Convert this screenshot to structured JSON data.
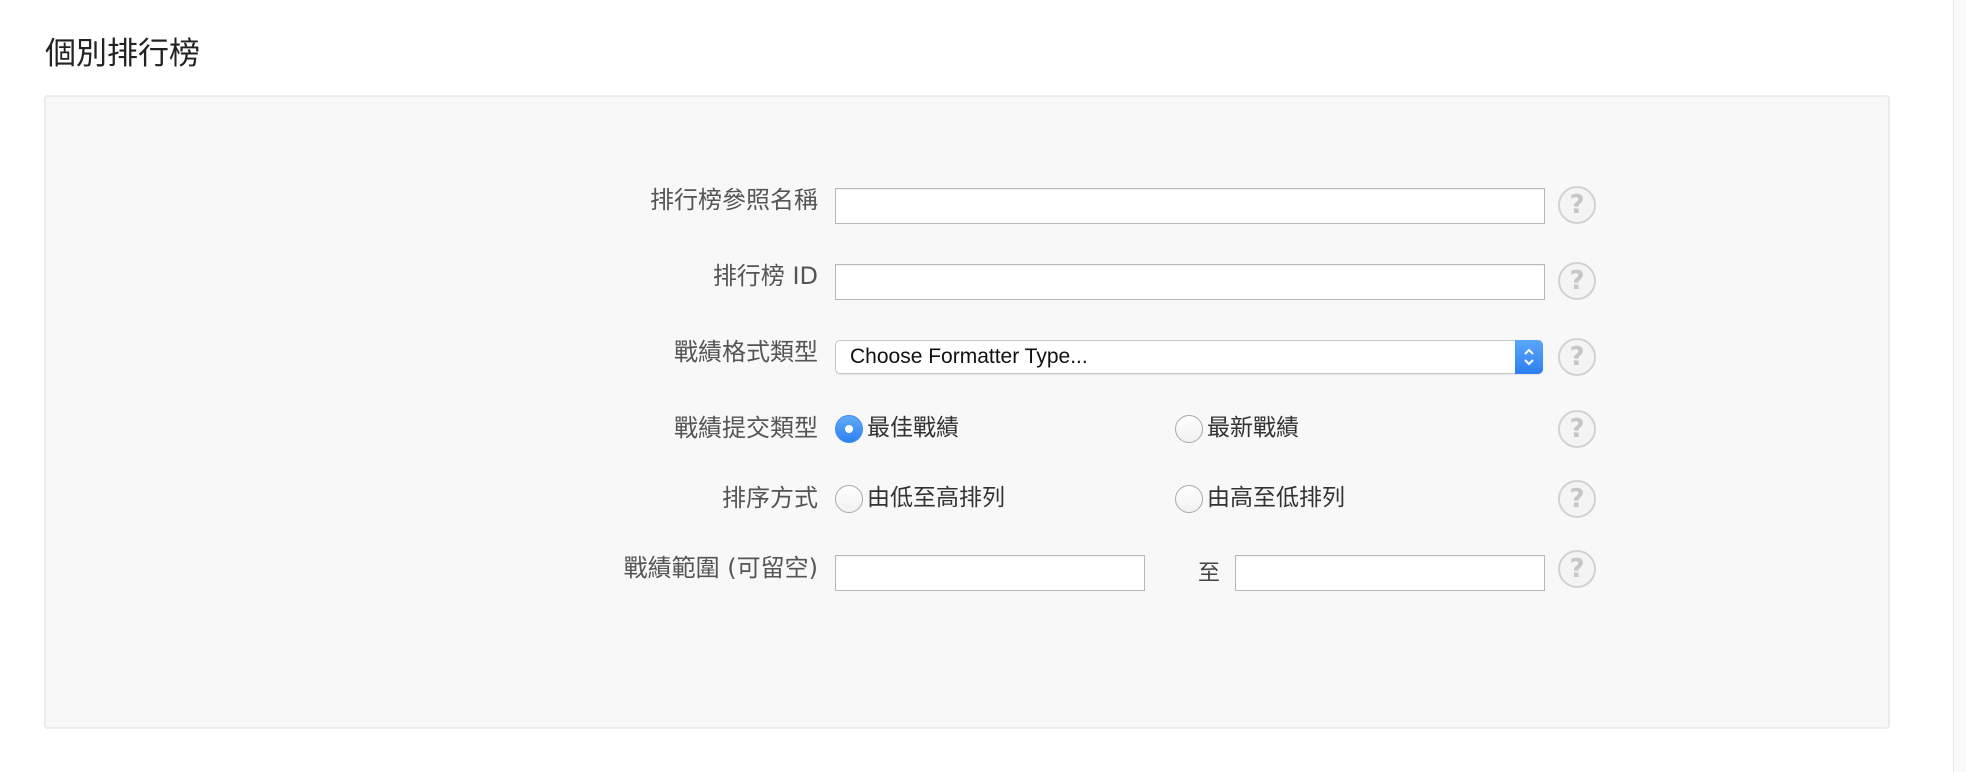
{
  "section_title": "個別排行榜",
  "form": {
    "reference_name": {
      "label": "排行榜參照名稱",
      "value": "",
      "help": "?"
    },
    "leaderboard_id": {
      "label": "排行榜 ID",
      "value": "",
      "help": "?"
    },
    "score_format_type": {
      "label": "戰績格式類型",
      "selected": "Choose Formatter Type...",
      "help": "?"
    },
    "score_submission_type": {
      "label": "戰績提交類型",
      "options": [
        {
          "label": "最佳戰績",
          "checked": true
        },
        {
          "label": "最新戰績",
          "checked": false
        }
      ],
      "help": "?"
    },
    "sort_order": {
      "label": "排序方式",
      "options": [
        {
          "label": "由低至高排列",
          "checked": false
        },
        {
          "label": "由高至低排列",
          "checked": false
        }
      ],
      "help": "?"
    },
    "score_range": {
      "label": "戰績範圍 (可留空)",
      "to_label": "至",
      "min_value": "",
      "max_value": "",
      "help": "?"
    }
  },
  "colors": {
    "accent": "#2f80f1",
    "panel_bg": "#f8f8f8",
    "panel_border": "#ececec"
  },
  "icons": {
    "help": "question-circle-icon",
    "select_arrows": "chevron-up-down-icon"
  }
}
